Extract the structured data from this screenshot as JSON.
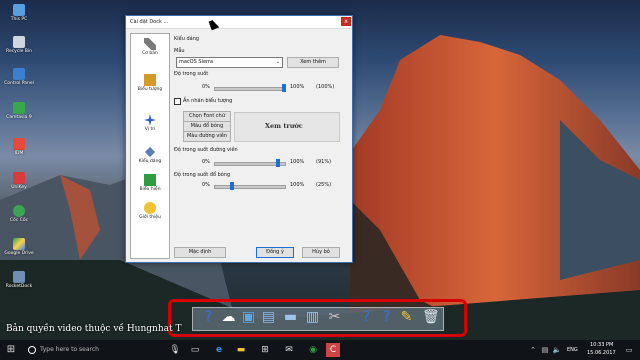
{
  "desktop_icons": [
    {
      "label": "This PC"
    },
    {
      "label": "Recycle Bin"
    },
    {
      "label": "Control Panel"
    },
    {
      "label": "Camtasia 9"
    },
    {
      "label": "IDM"
    },
    {
      "label": "UniKey"
    },
    {
      "label": "Cốc Cốc"
    },
    {
      "label": "Google Drive"
    },
    {
      "label": "RocketDock"
    }
  ],
  "dialog": {
    "title": "Cài đặt Dock ...",
    "close": "x",
    "nav": [
      "Cơ bản",
      "Biểu tượng",
      "Vị trí",
      "Kiểu dáng",
      "Biểu hiện",
      "Giới thiệu"
    ],
    "section_style": "Kiểu dáng",
    "theme_label": "Mẫu",
    "theme_value": "macOS Sierra",
    "view_more": "Xem thêm",
    "opacity_label": "Độ trong suốt",
    "opacity_min": "0%",
    "opacity_max": "100%",
    "opacity_value": "(100%)",
    "opacity_pct": 100,
    "hide_icons": "Ẩn nhãn biểu tượng",
    "choose_font": "Chọn Font chữ",
    "shadow_color": "Màu đổ bóng",
    "outline_color": "Màu đường viền",
    "preview": "Xem trước",
    "outline_label": "Độ trong suốt đường viền",
    "outline_min": "0%",
    "outline_max": "100%",
    "outline_value": "(91%)",
    "outline_pct": 91,
    "shadow_label": "Độ trong suốt đổ bóng",
    "shadow_min": "0%",
    "shadow_max": "100%",
    "shadow_value": "(25%)",
    "shadow_pct": 25,
    "default": "Mặc định",
    "ok": "Đồng ý",
    "cancel": "Hủy bỏ"
  },
  "dock_icons": [
    "?",
    "☁",
    "▣",
    "▤",
    "▬",
    "▥",
    "✂",
    "?",
    "?",
    "✎",
    "🗑"
  ],
  "watermark": "Bản quyền video thuộc về Hungnhat T",
  "taskbar": {
    "search_placeholder": "Type here to search",
    "language": "ENG",
    "time": "10:33 PM",
    "date": "15.06.2017"
  },
  "colors": {
    "accent": "#1e6fd6",
    "highlight_border": "#d60000"
  }
}
